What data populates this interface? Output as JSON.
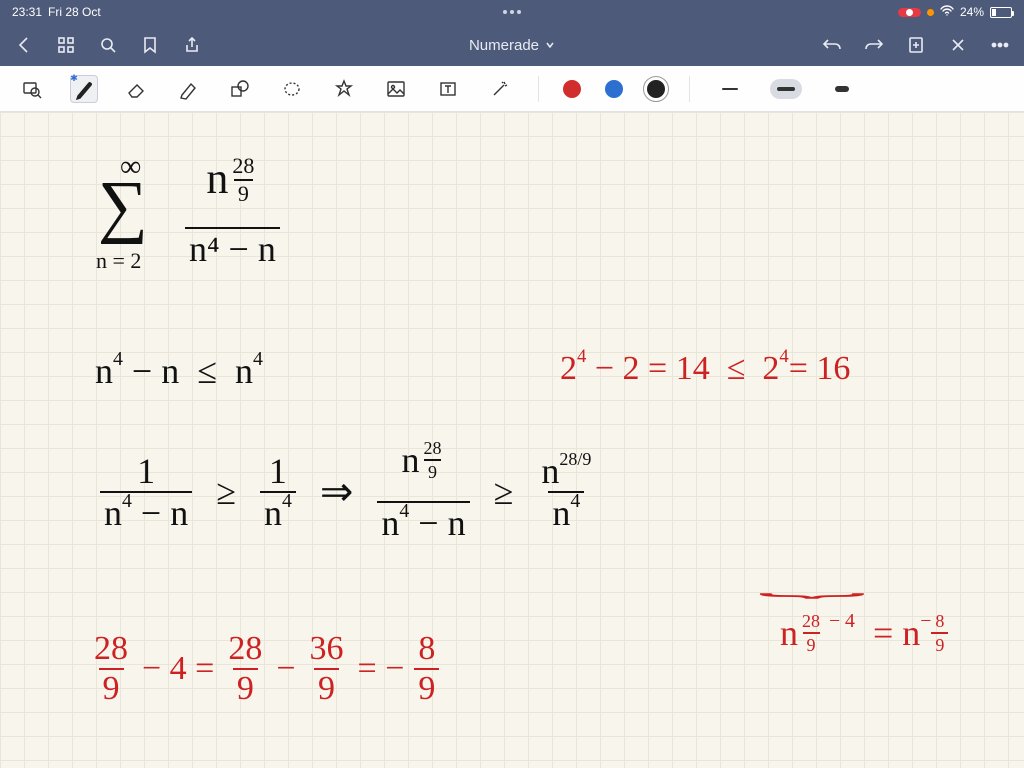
{
  "status": {
    "time": "23:31",
    "date": "Fri 28 Oct",
    "battery_pct": "24%",
    "rec_label": ""
  },
  "nav": {
    "title": "Numerade"
  },
  "tools": {
    "pen_selected": true,
    "colors": {
      "red": "#d12d2d",
      "blue": "#2d6fd1",
      "black": "#222"
    },
    "selected_color": "black",
    "selected_stroke": "medium"
  },
  "math": {
    "sum_upper": "∞",
    "sum_lower": "n = 2",
    "exp_frac_top": "28",
    "exp_frac_bot": "9",
    "term_num": "n",
    "term_den": "n⁴ − n",
    "line2_lhs": "n⁴ − n  ≤  n⁴",
    "line2_rhs": "2⁴ − 2 = 14  ≤  2⁴ = 16",
    "line3_a_num": "1",
    "line3_a_den": "n⁴ − n",
    "line3_b_num": "1",
    "line3_b_den": "n⁴",
    "geq": "≥",
    "implies": "⇒",
    "line3_c_num": "n",
    "line3_c_den": "n⁴ − n",
    "line3_d_num": "n",
    "line3_d_den": "n⁴",
    "exp_289": "28/9",
    "line4_text": "28⁄9 − 4 = 28⁄9 − 36⁄9 = − 8⁄9",
    "line4_r_base": "n",
    "line4_r_exp1": "28⁄9 − 4",
    "line4_r_eq": "= n",
    "line4_r_exp2": "− 8⁄9"
  }
}
